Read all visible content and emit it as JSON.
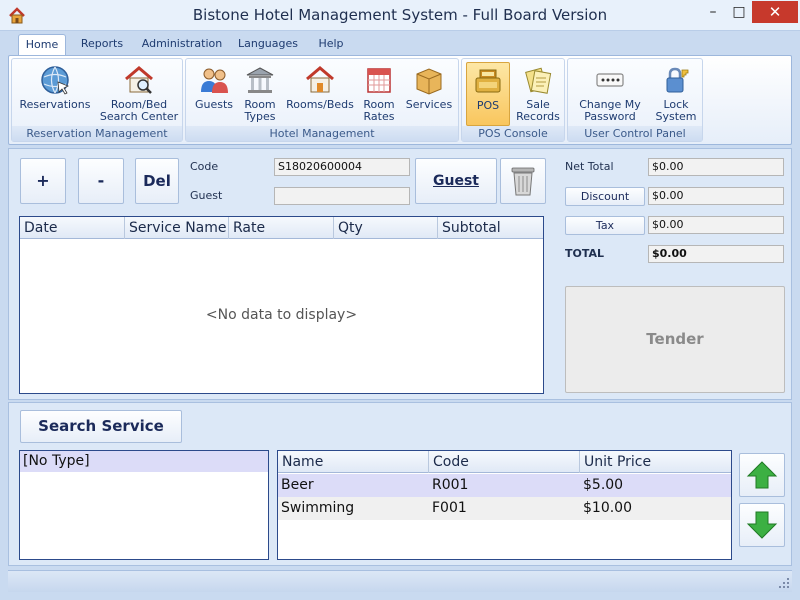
{
  "window": {
    "title": "Bistone Hotel Management System - Full Board Version",
    "minimize": "–",
    "maximize": "□",
    "close": "✕"
  },
  "tabs": [
    {
      "label": "Home",
      "active": true
    },
    {
      "label": "Reports"
    },
    {
      "label": "Administration"
    },
    {
      "label": "Languages"
    },
    {
      "label": "Help"
    }
  ],
  "ribbon": {
    "groups": [
      {
        "label": "Reservation Management",
        "buttons": [
          {
            "line1": "Reservations",
            "line2": "",
            "icon": "globe-icon"
          },
          {
            "line1": "Room/Bed",
            "line2": "Search Center",
            "icon": "house-search-icon"
          }
        ]
      },
      {
        "label": "Hotel Management",
        "buttons": [
          {
            "line1": "Guests",
            "line2": "",
            "icon": "users-icon"
          },
          {
            "line1": "Room",
            "line2": "Types",
            "icon": "building-icon"
          },
          {
            "line1": "Rooms/Beds",
            "line2": "",
            "icon": "house-icon"
          },
          {
            "line1": "Room",
            "line2": "Rates",
            "icon": "calendar-icon"
          },
          {
            "line1": "Services",
            "line2": "",
            "icon": "box-icon"
          }
        ]
      },
      {
        "label": "POS Console",
        "buttons": [
          {
            "line1": "POS",
            "line2": "",
            "icon": "cash-register-icon"
          },
          {
            "line1": "Sale",
            "line2": "Records",
            "icon": "receipts-icon"
          }
        ]
      },
      {
        "label": "User Control Panel",
        "buttons": [
          {
            "line1": "Change My",
            "line2": "Password",
            "icon": "password-icon"
          },
          {
            "line1": "Lock",
            "line2": "System",
            "icon": "lock-icon"
          }
        ]
      }
    ]
  },
  "pos": {
    "add": "+",
    "remove": "-",
    "delete": "Del",
    "code_label": "Code",
    "code_value": "S18020600004",
    "guest_label": "Guest",
    "guest_value": "",
    "guest_button": "Guest",
    "columns": [
      "Date",
      "Service Name",
      "Rate",
      "Qty",
      "Subtotal"
    ],
    "empty_text": "<No data to display>"
  },
  "totals": {
    "net_total_label": "Net Total",
    "net_total": "$0.00",
    "discount_label": "Discount",
    "discount": "$0.00",
    "tax_label": "Tax",
    "tax": "$0.00",
    "total_label": "TOTAL",
    "total": "$0.00",
    "tender": "Tender"
  },
  "services": {
    "search_button": "Search Service",
    "types": [
      "[No Type]"
    ],
    "columns": [
      "Name",
      "Code",
      "Unit Price"
    ],
    "rows": [
      {
        "name": "Beer",
        "code": "R001",
        "price": "$5.00"
      },
      {
        "name": "Swimming",
        "code": "F001",
        "price": "$10.00"
      }
    ]
  }
}
